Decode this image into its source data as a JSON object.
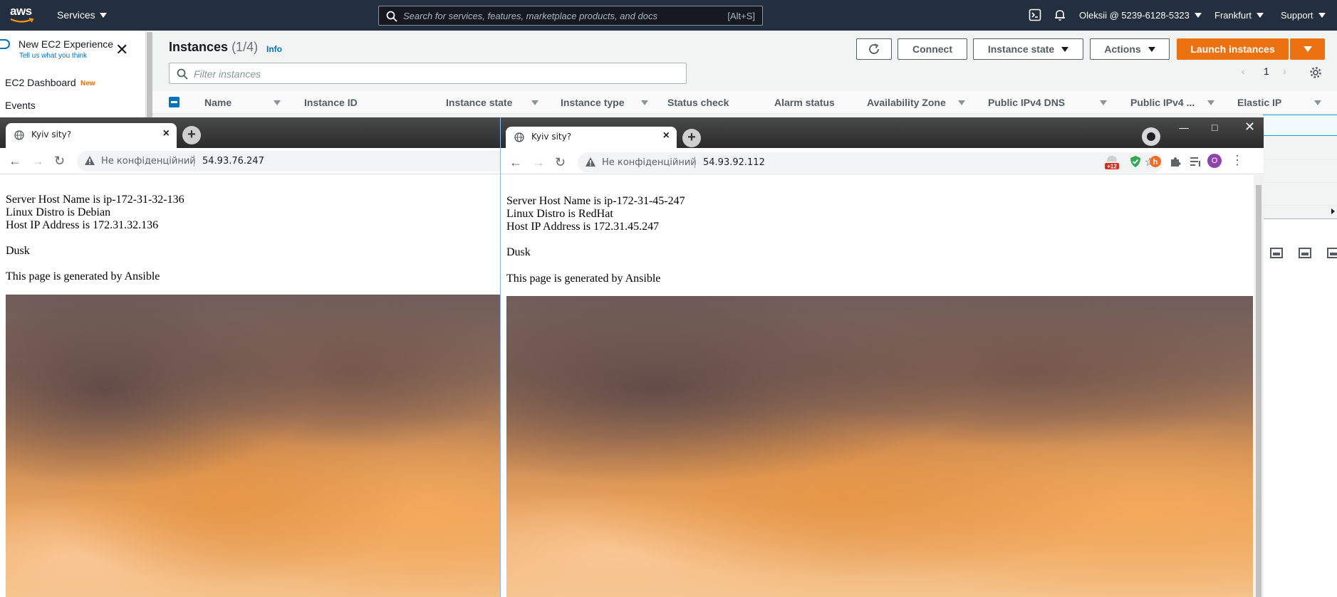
{
  "aws": {
    "logo": "aws",
    "services": "Services",
    "search_placeholder": "Search for services, features, marketplace products, and docs",
    "search_shortcut": "[Alt+S]",
    "account": "Oleksii @ 5239-6128-5323",
    "region": "Frankfurt",
    "support": "Support",
    "sidebar": {
      "new_experience": "New EC2 Experience",
      "tell_us": "Tell us what you think",
      "close": "✕",
      "dashboard": "EC2 Dashboard",
      "new_badge": "New",
      "events": "Events"
    },
    "instances": {
      "title": "Instances",
      "count": "(1/4)",
      "info": "Info",
      "connect": "Connect",
      "instance_state": "Instance state",
      "actions": "Actions",
      "launch": "Launch instances",
      "filter_placeholder": "Filter instances",
      "page": "1",
      "columns": [
        "Name",
        "Instance ID",
        "Instance state",
        "Instance type",
        "Status check",
        "Alarm status",
        "Availability Zone",
        "Public IPv4 DNS",
        "Public IPv4 ...",
        "Elastic IP"
      ]
    }
  },
  "browser_left": {
    "tab_title": "Kyiv sity?",
    "not_secure": "Не конфіденційний",
    "url": "54.93.76.247",
    "lines": [
      "Server Host Name is ip-172-31-32-136",
      "Linux Distro is Debian",
      "Host IP Address is 172.31.32.136",
      "Dusk",
      "This page is generated by Ansible"
    ]
  },
  "browser_right": {
    "tab_title": "Kyiv sity?",
    "not_secure": "Не конфіденційний",
    "url": "54.93.92.112",
    "profile_initial": "O",
    "ext_badge": "+12",
    "lines": [
      "Server Host Name is ip-172-31-45-247",
      "Linux Distro is RedHat",
      "Host IP Address is 172.31.45.247",
      "Dusk",
      "This page is generated by Ansible"
    ]
  },
  "colors": {
    "aws_nav": "#232f3e",
    "aws_orange": "#ec7211",
    "aws_link": "#0073bb"
  }
}
